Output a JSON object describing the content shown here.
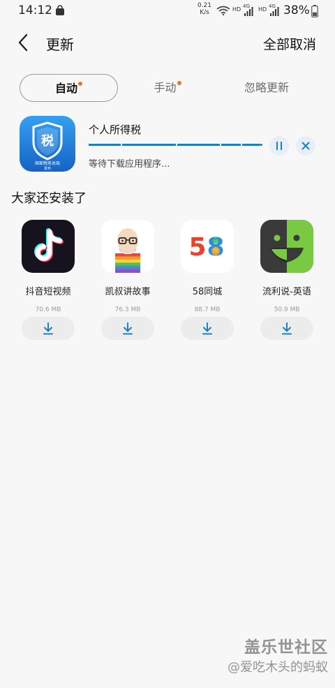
{
  "status_bar": {
    "time": "14:12",
    "net_speed_value": "0.21",
    "net_speed_unit": "K/s",
    "sim1": {
      "hd": "HD",
      "gen": "4G"
    },
    "sim2": {
      "hd": "HD",
      "gen": "4G"
    },
    "battery": "38%",
    "battery_level": 0.38
  },
  "header": {
    "title": "更新",
    "cancel_all": "全部取消"
  },
  "tabs": [
    {
      "label": "自动",
      "active": true,
      "dot": true
    },
    {
      "label": "手动",
      "active": false,
      "dot": true
    },
    {
      "label": "忽略更新",
      "active": false,
      "dot": false
    }
  ],
  "updating": {
    "name": "个人所得税",
    "status": "等待下载应用程序...",
    "progress": 0.98,
    "icon_char": "税",
    "icon_caption_1": "国家税务总局",
    "icon_caption_2": "发布",
    "icon_colors": [
      "#2f8fe8",
      "#1667c9"
    ]
  },
  "recommend": {
    "title": "大家还安装了",
    "apps": [
      {
        "name": "抖音短视频",
        "size": "70.6 MB",
        "icon": "tiktok-icon"
      },
      {
        "name": "凯叔讲故事",
        "size": "76.3 MB",
        "icon": "storyteller-icon"
      },
      {
        "name": "58同城",
        "size": "88.7 MB",
        "icon": "58-icon",
        "icon_text_1": "5",
        "icon_text_2": "8"
      },
      {
        "name": "流利说-英语",
        "size": "50.9 MB",
        "icon": "liulishuo-icon"
      }
    ]
  },
  "watermark": {
    "brand": "盖乐世社区",
    "user": "@爱吃木头的蚂蚁"
  },
  "colors": {
    "accent_blue": "#1d7fbf",
    "badge_orange": "#e07b26",
    "background": "#f7f7f7"
  }
}
